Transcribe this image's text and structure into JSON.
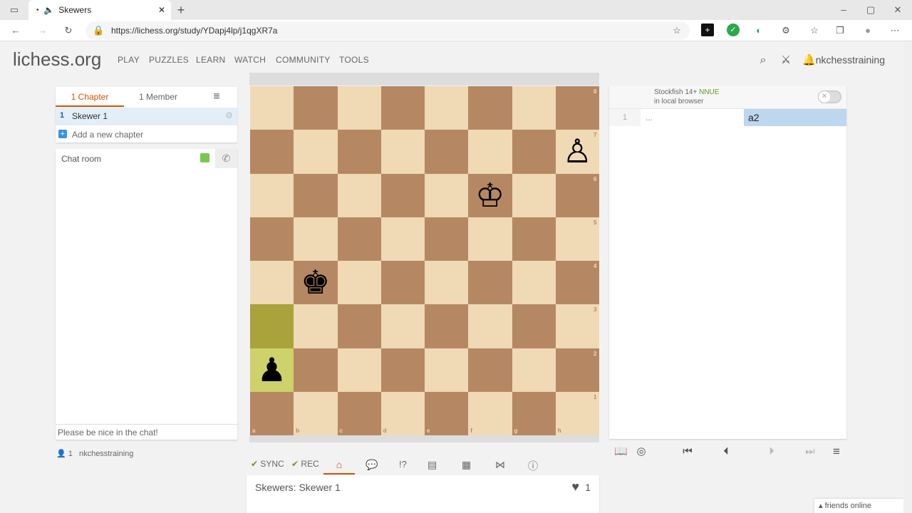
{
  "browser": {
    "tab_title": "Skewers",
    "url": "https://lichess.org/study/YDapj4lp/j1qgXR7a"
  },
  "header": {
    "logo": "lichess.org",
    "nav": [
      "PLAY",
      "PUZZLES",
      "LEARN",
      "WATCH",
      "COMMUNITY",
      "TOOLS"
    ],
    "username": "nkchesstraining"
  },
  "study": {
    "tabs": [
      "1 Chapter",
      "1 Member"
    ],
    "chapter_num": "1",
    "chapter_name": "Skewer 1",
    "add_chapter": "Add a new chapter",
    "chat_title": "Chat room",
    "chat_placeholder": "Please be nice in the chat!",
    "members_count": "1",
    "member_name": "nkchesstraining"
  },
  "board": {
    "files": [
      "a",
      "b",
      "c",
      "d",
      "e",
      "f",
      "g",
      "h"
    ],
    "ranks": [
      "8",
      "7",
      "6",
      "5",
      "4",
      "3",
      "2",
      "1"
    ],
    "pieces": [
      {
        "glyph": "♙",
        "color": "white",
        "sq": "h7"
      },
      {
        "glyph": "♔",
        "color": "white",
        "sq": "f6"
      },
      {
        "glyph": "♚",
        "color": "black",
        "sq": "b4"
      },
      {
        "glyph": "♟",
        "color": "black",
        "sq": "a2"
      }
    ],
    "highlights": [
      "a3",
      "a2"
    ]
  },
  "toolbar": {
    "sync": "SYNC",
    "rec": "REC"
  },
  "game": {
    "title": "Skewers: Skewer 1",
    "likes": "1"
  },
  "engine": {
    "name": "Stockfish 14+",
    "nnue": "NNUE",
    "location": "in local browser"
  },
  "moves": {
    "num": "1",
    "white": "...",
    "black": "a2"
  },
  "footer": {
    "friends": "friends online"
  },
  "colors": {
    "accent": "#d85000",
    "light_square": "#f0d9b5",
    "dark_square": "#b58863",
    "highlight": "#aaa23a",
    "nnue": "#629924"
  }
}
